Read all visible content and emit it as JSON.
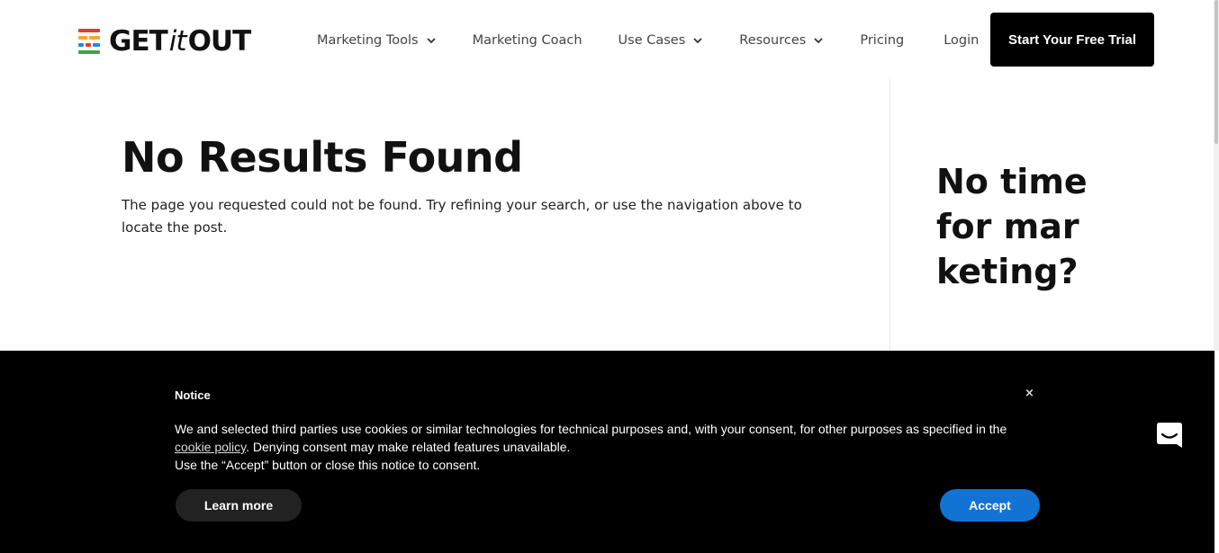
{
  "header": {
    "logo": {
      "get": "GET",
      "it": "it",
      "out": "OUT",
      "colors": [
        "#e53935",
        "#f9a825",
        "#1e88e5",
        "#43a047"
      ]
    },
    "nav": [
      {
        "label": "Marketing Tools",
        "dropdown": true
      },
      {
        "label": "Marketing Coach",
        "dropdown": false
      },
      {
        "label": "Use Cases",
        "dropdown": true
      },
      {
        "label": "Resources",
        "dropdown": true
      },
      {
        "label": "Pricing",
        "dropdown": false
      },
      {
        "label": "Login",
        "dropdown": false
      }
    ],
    "cta": "Start Your Free Trial"
  },
  "main": {
    "title": "No Results Found",
    "text": "The page you requested could not be found. Try refining your search, or use the navigation above to locate the post."
  },
  "sidebar": {
    "title": "No time for marketing?"
  },
  "cookie_notice": {
    "title": "Notice",
    "close": "×",
    "body_part1": "We and selected third parties use cookies or similar technologies for technical purposes and, with your consent, for other purposes as specified in the ",
    "link": "cookie policy",
    "body_part2": ". Denying consent may make related features unavailable.",
    "body_line2": "Use the “Accept” button or close this notice to consent.",
    "learn_more": "Learn more",
    "accept": "Accept",
    "accept_color": "#1173d4"
  },
  "icons": {
    "chat": "chat-bubble-icon",
    "chevron": "chevron-down-icon",
    "close": "close-icon"
  }
}
